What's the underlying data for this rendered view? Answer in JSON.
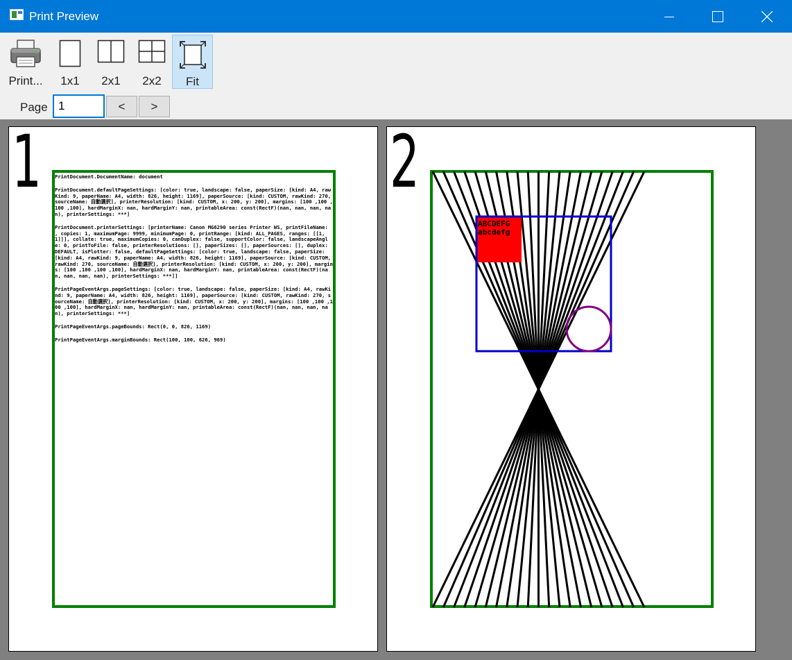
{
  "window": {
    "title": "Print Preview",
    "icons": [
      "app-icon",
      "minimize-icon",
      "maximize-icon",
      "close-icon"
    ]
  },
  "toolbar": {
    "print_label": "Print...",
    "one_by_one_label": "1x1",
    "two_by_one_label": "2x1",
    "two_by_two_label": "2x2",
    "fit_label": "Fit",
    "active": "Fit",
    "page_label": "Page",
    "page_value": "1",
    "prev_label": "<",
    "next_label": ">"
  },
  "pages": [
    {
      "number": "1",
      "lines": [
        "PrintDocument.DocumentName: document",
        "PrintDocument.defaultPageSettings: [color: true, landscape: false, paperSize: [kind: A4, rawKind: 9, paperName: A4, width: 826, height: 1169], paperSource: [kind: CUSTOM, rawKind: 270, sourceName: 自動選択], printerResolution: [kind: CUSTOM, x: 200, y: 200], margins: [100 ,100 ,100 ,100], hardMarginX: nan, hardMarginY: nan, printableArea: const(RectF)(nan, nan, nan, nan), printerSettings: ***]",
        "PrintDocument.printerSettings: [printerName: Canon MG6290 series Printer WS, printFileName: , copies: 1, maximumPage: 9999, minimumPage: 0, printRange: [kind: ALL_PAGES, ranges: [[1, 1]]], collate: true, maximumCopies: 0, canDuplex: false, supportColor: false, landscapeAngle: 0, printToFile: false, printerResolutions: [], paperSizes: [], paperSources: [], duplex: DEFAULT, isPlotter: false, defaultPageSettings: [color: true, landscape: false, paperSize: [kind: A4, rawKind: 9, paperName: A4, width: 826, height: 1169], paperSource: [kind: CUSTOM, rawKind: 270, sourceName: 自動選択], printerResolution: [kind: CUSTOM, x: 200, y: 200], margins: [100 ,100 ,100 ,100], hardMarginX: nan, hardMarginY: nan, printableArea: const(RectF)(nan, nan, nan, nan), printerSettings: ***]]",
        "PrintPageEventArgs.pageSettings: [color: true, landscape: false, paperSize: [kind: A4, rawKind: 9, paperName: A4, width: 826, height: 1169], paperSource: [kind: CUSTOM, rawKind: 270, sourceName: 自動選択], printerResolution: [kind: CUSTOM, x: 200, y: 200], margins: [100 ,100 ,100 ,100], hardMarginX: nan, hardMarginY: nan, printableArea: const(RectF)(nan, nan, nan, nan), printerSettings: ***]",
        "PrintPageEventArgs.pageBounds: Rect(0, 0, 826, 1169)",
        "PrintPageEventArgs.marginBounds: Rect(100, 100, 626, 969)"
      ]
    },
    {
      "number": "2",
      "red_box_text": [
        "ABCDEFG",
        "abcdefg"
      ]
    }
  ],
  "colors": {
    "titlebar": "#0078d7",
    "margin_box": "#008000",
    "blue_rect": "#0000cc",
    "red_fill": "#ff0000",
    "circle": "#800080",
    "preview_bg": "#808080"
  }
}
